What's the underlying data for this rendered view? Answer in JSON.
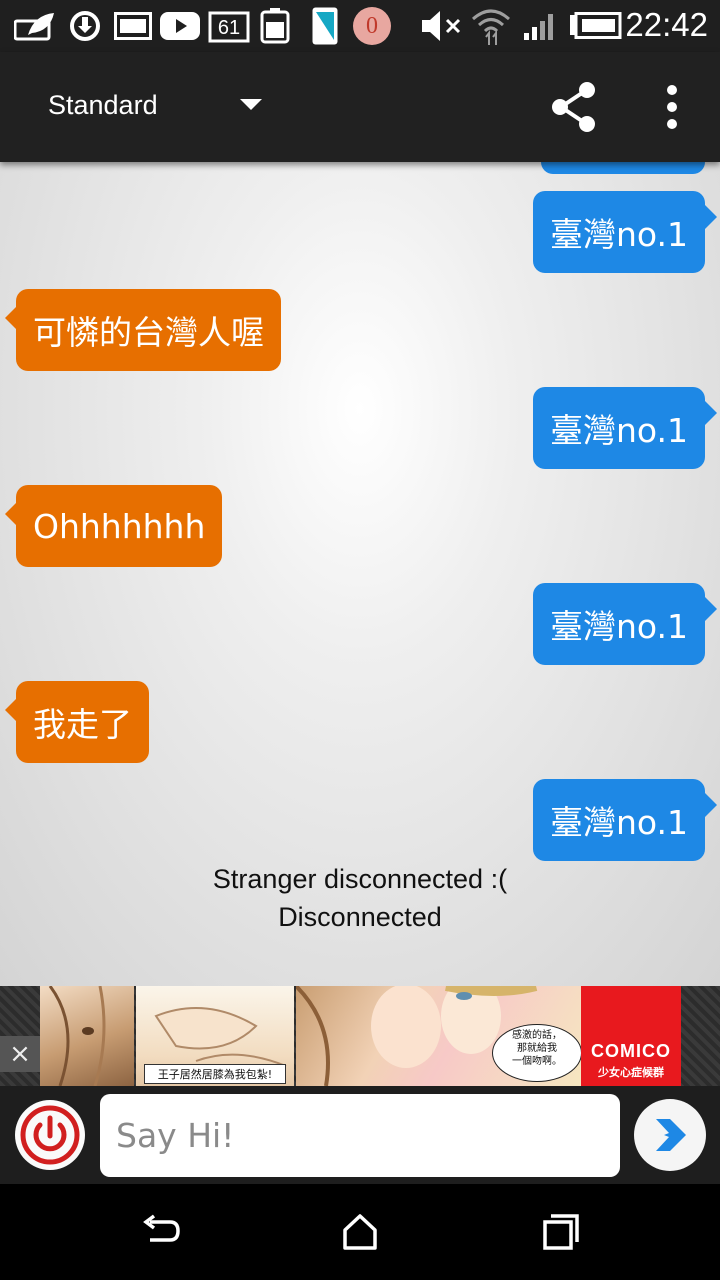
{
  "status_bar": {
    "time": "22:42",
    "notification_count": "0",
    "icons": [
      "leaf-icon",
      "sync-icon",
      "image-icon",
      "youtube-icon",
      "calendar-61-icon",
      "battery-saver-icon",
      "phone-icon",
      "notification-badge-icon",
      "mute-icon",
      "wifi-icon",
      "signal-icon",
      "battery-icon"
    ],
    "calendar_day": "61"
  },
  "app_bar": {
    "mode": "Standard",
    "icons": [
      "dropdown-caret-icon",
      "share-icon",
      "overflow-menu-icon"
    ]
  },
  "messages": [
    {
      "sender": "me",
      "text": "臺灣no.1"
    },
    {
      "sender": "stranger",
      "text": "可憐的台灣人喔"
    },
    {
      "sender": "me",
      "text": "臺灣no.1"
    },
    {
      "sender": "stranger",
      "text": "Ohhhhhhh"
    },
    {
      "sender": "me",
      "text": "臺灣no.1"
    },
    {
      "sender": "stranger",
      "text": "我走了"
    },
    {
      "sender": "me",
      "text": "臺灣no.1"
    }
  ],
  "status_messages": {
    "stranger_disconnected": "Stranger disconnected :(",
    "disconnected": "Disconnected"
  },
  "ad": {
    "caption": "王子居然居膝為我包紮!",
    "speech": "感激的話，\n那就給我\n一個吻啊。",
    "brand": "COMICO",
    "tagline": "少女心症候群",
    "close_label": "×"
  },
  "input": {
    "placeholder": "Say Hi!",
    "value": ""
  },
  "colors": {
    "my_bubble": "#1e88e5",
    "stranger_bubble": "#e76f00",
    "toolbar": "#212121",
    "power_icon": "#d11f1f",
    "send_icon": "#1e88e5",
    "ad_brand": "#e8191e"
  }
}
